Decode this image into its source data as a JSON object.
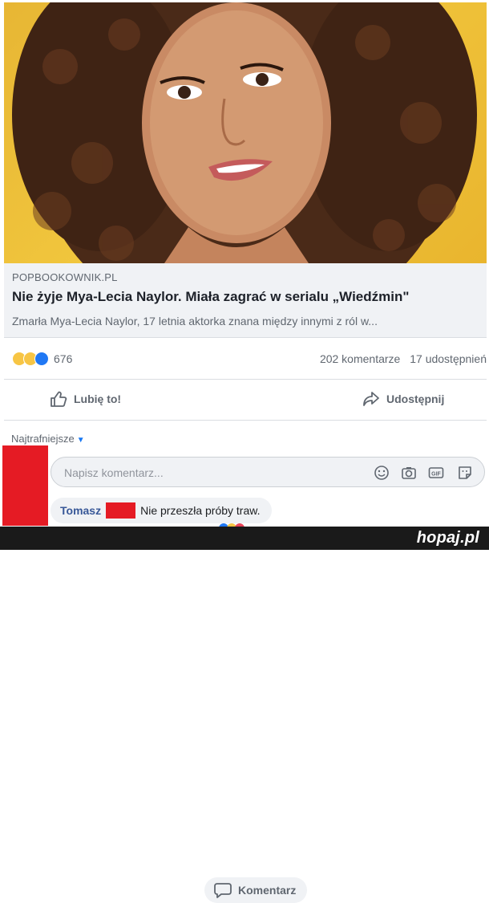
{
  "post": {
    "preview": {
      "source": "POPBOOKOWNIK.PL",
      "headline": "Nie żyje Mya-Lecia Naylor. Miała zagrać w serialu „Wiedźmin\"",
      "description": "Zmarła Mya-Lecia Naylor, 17 letnia aktorka znana między innymi z ról w..."
    },
    "reactions": {
      "icons": [
        "sad-icon",
        "wow-icon",
        "like-icon"
      ],
      "count": "676",
      "comments": "202 komentarze",
      "shares": "17 udostępnień"
    },
    "actions": {
      "like": "Lubię to!",
      "comment": "Komentarz",
      "share": "Udostępnij"
    }
  },
  "comments": {
    "sort_label": "Najtrafniejsze",
    "input_placeholder": "Napisz komentarz...",
    "input_icons": [
      "emoji-icon",
      "camera-icon",
      "gif-icon",
      "sticker-icon"
    ],
    "items": [
      {
        "author": "Tomasz",
        "text": "Nie przeszła próby traw."
      }
    ]
  },
  "footer": {
    "brand": "hopaj.pl"
  },
  "colors": {
    "hero_background": "#f1c63d",
    "like_blue": "#2078f4",
    "redaction_red": "#e51b24",
    "author_blue": "#385898"
  }
}
